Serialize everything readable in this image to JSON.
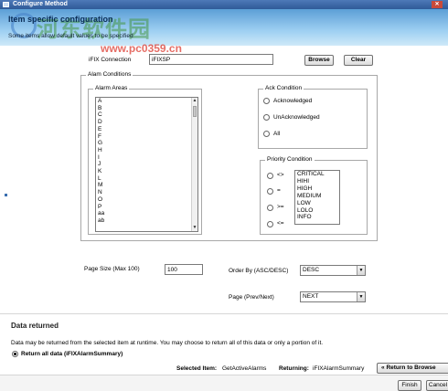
{
  "window": {
    "title": "Configure Method"
  },
  "header": {
    "title": "Item specific configuration",
    "subtitle": "Some items allow default values to be specified",
    "watermark": "河东软件园",
    "watermark_url": "www.pc0359.cn"
  },
  "connection": {
    "label": "iFIX Connection",
    "value": "iFIXSP",
    "browse_label": "Browse",
    "clear_label": "Clear"
  },
  "alarm_conditions": {
    "legend": "Alam Conditions",
    "alarm_areas": {
      "legend": "Alarm Areas",
      "items": [
        "A",
        "B",
        "C",
        "D",
        "E",
        "F",
        "G",
        "H",
        "I",
        "J",
        "K",
        "L",
        "M",
        "N",
        "O",
        "P",
        "aa",
        "ab"
      ]
    },
    "ack_condition": {
      "legend": "Ack Condition",
      "options": [
        "Acknowledged",
        "UnAcknowledged",
        "All"
      ]
    },
    "priority_condition": {
      "legend": "Priority Condition",
      "operators": [
        "<>",
        "=",
        ">=",
        "<="
      ],
      "levels": [
        "CRITICAL",
        "HIHI",
        "HIGH",
        "MEDIUM",
        "LOW",
        "LOLO",
        "INFO"
      ]
    }
  },
  "page_size": {
    "label": "Page Size (Max 100)",
    "value": "100"
  },
  "order_by": {
    "label": "Order By (ASC/DESC)",
    "value": "DESC"
  },
  "page_nav": {
    "label": "Page (Prev/Next)",
    "value": "NEXT"
  },
  "data_returned": {
    "title": "Data returned",
    "description": "Data may be returned from the selected item at runtime. You may choose to return all of this data or only a portion of it.",
    "return_all_label": "Return all data (iFIXAlarmSummary)",
    "selected_item_label": "Selected Item:",
    "selected_item_value": "GetActiveAlarms",
    "returning_label": "Returning:",
    "returning_value": "iFIXAlarmSummary",
    "return_button_label": "Return to Browse"
  },
  "footer": {
    "finish_label": "Finish",
    "cancel_label": "Cancel"
  },
  "colors": {
    "header_top": "#5c9fd6",
    "header_bottom": "#cfe9f8",
    "titlebar": "#2f5a98"
  }
}
